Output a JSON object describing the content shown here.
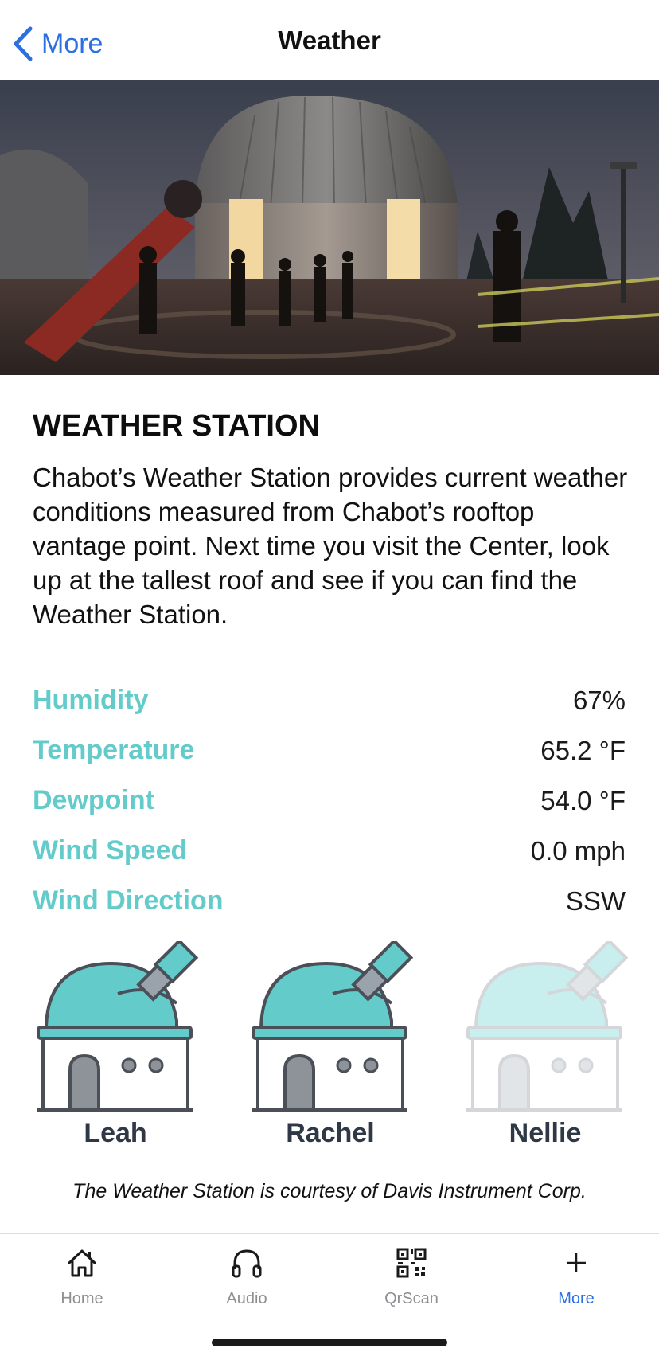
{
  "navbar": {
    "back_label": "More",
    "title": "Weather"
  },
  "hero": {
    "icon": "observatory-photo"
  },
  "section": {
    "heading": "WEATHER STATION",
    "description": "Chabot’s Weather Station provides current weather conditions measured from Chabot’s rooftop vantage point. Next time you visit the Center, look up at the tallest roof and see if you can find the Weather Station."
  },
  "readings": [
    {
      "label": "Humidity",
      "value": "67%"
    },
    {
      "label": "Temperature",
      "value": "65.2 °F"
    },
    {
      "label": "Dewpoint",
      "value": "54.0 °F"
    },
    {
      "label": "Wind Speed",
      "value": "0.0 mph"
    },
    {
      "label": "Wind Direction",
      "value": "SSW"
    }
  ],
  "observatories": [
    {
      "name": "Leah",
      "icon": "observatory-icon"
    },
    {
      "name": "Rachel",
      "icon": "observatory-icon"
    },
    {
      "name": "Nellie",
      "icon": "observatory-icon"
    }
  ],
  "courtesy": "The Weather Station is courtesy of Davis Instrument Corp.",
  "tabbar": {
    "items": [
      {
        "label": "Home",
        "icon": "home-icon"
      },
      {
        "label": "Audio",
        "icon": "headphones-icon"
      },
      {
        "label": "QrScan",
        "icon": "qr-code-icon"
      },
      {
        "label": "More",
        "icon": "plus-icon"
      }
    ],
    "active": "More"
  },
  "colors": {
    "accent": "#2b6fe0",
    "teal": "#64cbcb",
    "teal_light": "#c8eeee",
    "inactive_tab": "#8e8e93"
  }
}
